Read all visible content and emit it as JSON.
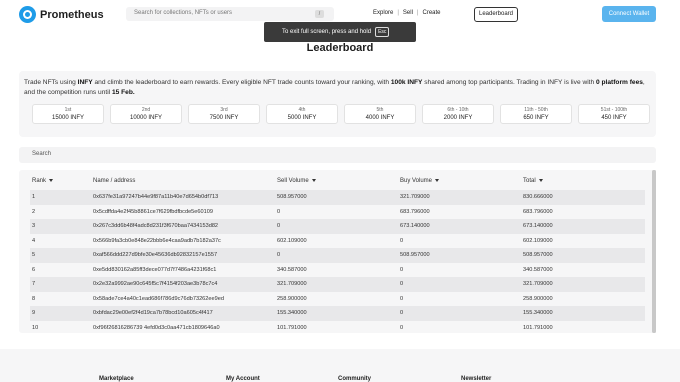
{
  "header": {
    "brand": "Prometheus",
    "search_placeholder": "Search for collections, NFTs or users",
    "search_shortcut": "/",
    "nav": [
      "Explore",
      "Sell",
      "Create"
    ],
    "leaderboard_button": "Leaderboard",
    "connect_button": "Connect Wallet"
  },
  "toast": {
    "text": "To exit full screen, press and hold",
    "key": "Esc"
  },
  "page": {
    "title": "Leaderboard"
  },
  "info": {
    "p1": "Trade NFTs using ",
    "b1": "INFY",
    "p2": " and climb the leaderboard to earn rewards. Every eligible NFT trade counts toward your ranking, with ",
    "b2": "100k INFY",
    "p3": " shared among top participants. Trading in INFY is live with ",
    "b3": "0 platform fees",
    "p4": ", and the competition runs until ",
    "b4": "15 Feb.",
    "tiers": [
      {
        "rank": "1st",
        "prize": "15000 INFY"
      },
      {
        "rank": "2nd",
        "prize": "10000 INFY"
      },
      {
        "rank": "3rd",
        "prize": "7500 INFY"
      },
      {
        "rank": "4th",
        "prize": "5000 INFY"
      },
      {
        "rank": "5th",
        "prize": "4000 INFY"
      },
      {
        "rank": "6th - 10th",
        "prize": "2000 INFY"
      },
      {
        "rank": "11th - 50th",
        "prize": "650 INFY"
      },
      {
        "rank": "51st - 100th",
        "prize": "450 INFY"
      }
    ]
  },
  "list_search": "Search",
  "table": {
    "headers": [
      "Rank",
      "Name / address",
      "Sell Volume",
      "Buy Volume",
      "Total"
    ],
    "rows": [
      [
        "1",
        "0x637fe31a97247b44e9f87a11b40e7d654b0df713",
        "508.957000",
        "321.709000",
        "830.666000"
      ],
      [
        "2",
        "0x5cdffda4e2f45b8861ce7f629fbdfbcde5e60109",
        "0",
        "683.796000",
        "683.796000"
      ],
      [
        "3",
        "0x267c3dd6b48f4adc8d231f3f670baa7434153d82",
        "0",
        "673.140000",
        "673.140000"
      ],
      [
        "4",
        "0x566b9fa3cb0e848e22bbb6e4caa9adb7b182a37c",
        "602.109000",
        "0",
        "602.109000"
      ],
      [
        "5",
        "0xaf566ddd227d9bfe30e45636db92832157e1557",
        "0",
        "508.957000",
        "508.957000"
      ],
      [
        "6",
        "0xe5dd830162a85ff3dece077d7f7486a4231f68c1",
        "340.587000",
        "0",
        "340.587000"
      ],
      [
        "7",
        "0x2e32a9992ae90c645f5c7f4154f203ae3b78c7c4",
        "321.709000",
        "0",
        "321.709000"
      ],
      [
        "8",
        "0x58ade7ce4a40c1ead686f786d9c76db73262ee9ed",
        "258.900000",
        "0",
        "258.900000"
      ],
      [
        "9",
        "0xbfdac29e00ef2f4d19ca7b78bcd10a605c4f417",
        "155.340000",
        "0",
        "155.340000"
      ],
      [
        "10",
        "0xf96f26816286739 4efd0d3c0aa471cb1809646a0",
        "101.791000",
        "0",
        "101.791000"
      ]
    ]
  },
  "footer": [
    "Marketplace",
    "My Account",
    "Community",
    "Newsletter"
  ]
}
